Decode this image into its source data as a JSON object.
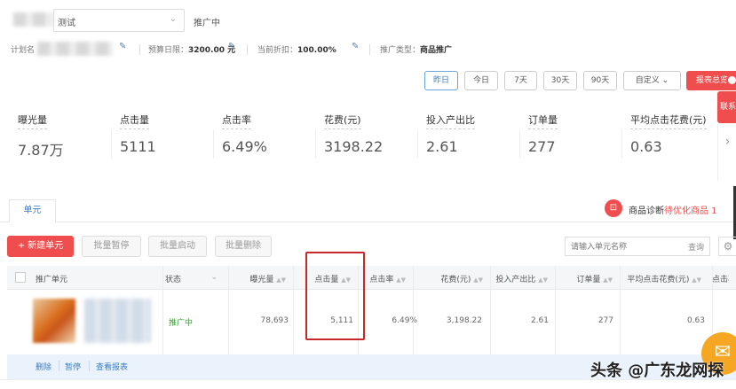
{
  "header": {
    "plan_select": "测试",
    "plan_status": "推广中"
  },
  "info": {
    "plan_name_label": "计划名",
    "budget_label": "预算日限：",
    "budget_value": "3200.00 元",
    "discount_label": "当前折扣：",
    "discount_value": "100.00%",
    "type_label": "推广类型：",
    "type_value": "商品推广"
  },
  "date_buttons": [
    "昨日",
    "今日",
    "7天",
    "30天",
    "90天",
    "自定义"
  ],
  "report_button": "报表总览",
  "contact_tab": "联系",
  "metrics": [
    {
      "label": "曝光量",
      "value": "7.87万"
    },
    {
      "label": "点击量",
      "value": "5111"
    },
    {
      "label": "点击率",
      "value": "6.49%"
    },
    {
      "label": "花费(元)",
      "value": "3198.22"
    },
    {
      "label": "投入产出比",
      "value": "2.61"
    },
    {
      "label": "订单量",
      "value": "277"
    },
    {
      "label": "平均点击花费(元)",
      "value": "0.63"
    }
  ],
  "tab": "单元",
  "diagnosis": {
    "label": "商品诊断",
    "link": "待优化商品 1"
  },
  "toolbar": {
    "new": "+ 新建单元",
    "pause": "批量暂停",
    "start": "批量启动",
    "delete": "批量删除",
    "search_placeholder": "请输入单元名称",
    "search_btn": "查询"
  },
  "table": {
    "headers": [
      "推广单元",
      "状态",
      "曝光量",
      "点击量",
      "点击率",
      "花费(元)",
      "投入产出比",
      "订单量",
      "平均点击花费(元)",
      "点击率"
    ],
    "row": {
      "status": "推广中",
      "impressions": "78,693",
      "clicks": "5,111",
      "ctr": "6.49%",
      "cost": "3,198.22",
      "roi": "2.61",
      "orders": "277",
      "cpc": "0.63"
    },
    "actions": [
      "删除",
      "暂停",
      "查看报表"
    ]
  },
  "watermark": "头条 @广东龙网探",
  "colors": {
    "accent": "#f04e4e",
    "status_green": "#3a9a3a",
    "link_blue": "#3a7cc2"
  }
}
